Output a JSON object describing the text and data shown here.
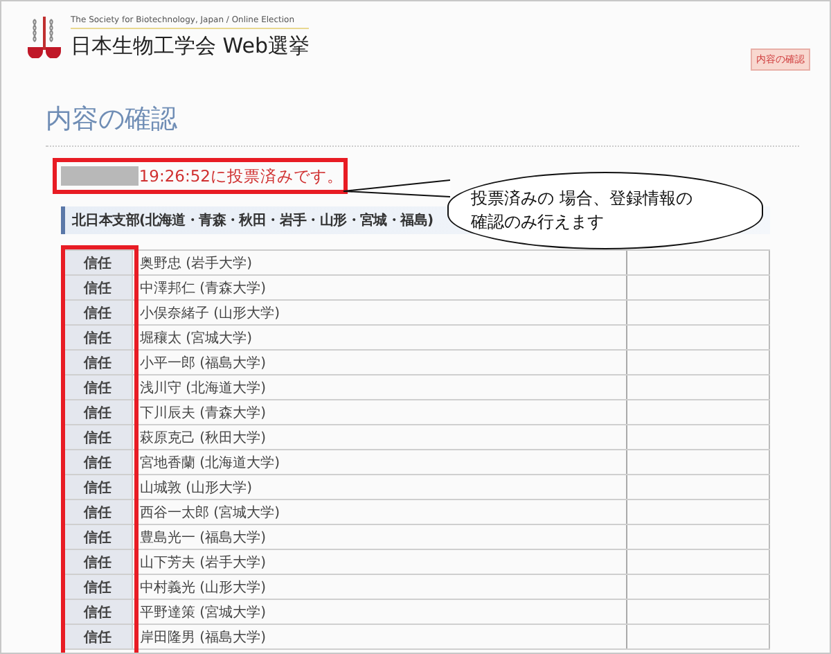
{
  "header": {
    "subtitle": "The Society for Biotechnology, Japan / Online Election",
    "title": "日本生物工学会 Web選挙",
    "badge": "内容の確認"
  },
  "heading": "内容の確認",
  "vote_notice": "19:26:52に投票済みです。",
  "callout": {
    "lines": [
      "投票済みの 場合、登録情報の",
      "確認のみ行えます"
    ]
  },
  "section": {
    "title": "北日本支部(北海道・青森・秋田・岩手・山形・宮城・福島)"
  },
  "table": {
    "rows": [
      {
        "vote": "信任",
        "candidate": "奥野忠 (岩手大学)"
      },
      {
        "vote": "信任",
        "candidate": "中澤邦仁 (青森大学)"
      },
      {
        "vote": "信任",
        "candidate": "小俣奈緒子 (山形大学)"
      },
      {
        "vote": "信任",
        "candidate": "堀穰太 (宮城大学)"
      },
      {
        "vote": "信任",
        "candidate": "小平一郎 (福島大学)"
      },
      {
        "vote": "信任",
        "candidate": "浅川守 (北海道大学)"
      },
      {
        "vote": "信任",
        "candidate": "下川辰夫 (青森大学)"
      },
      {
        "vote": "信任",
        "candidate": "萩原克己 (秋田大学)"
      },
      {
        "vote": "信任",
        "candidate": "宮地香蘭 (北海道大学)"
      },
      {
        "vote": "信任",
        "candidate": "山城敦 (山形大学)"
      },
      {
        "vote": "信任",
        "candidate": "西谷一太郎 (宮城大学)"
      },
      {
        "vote": "信任",
        "candidate": "豊島光一 (福島大学)"
      },
      {
        "vote": "信任",
        "candidate": "山下芳夫 (岩手大学)"
      },
      {
        "vote": "信任",
        "candidate": "中村義光 (山形大学)"
      },
      {
        "vote": "信任",
        "candidate": "平野達策 (宮城大学)"
      },
      {
        "vote": "信任",
        "candidate": "岸田隆男 (福島大学)"
      }
    ]
  }
}
